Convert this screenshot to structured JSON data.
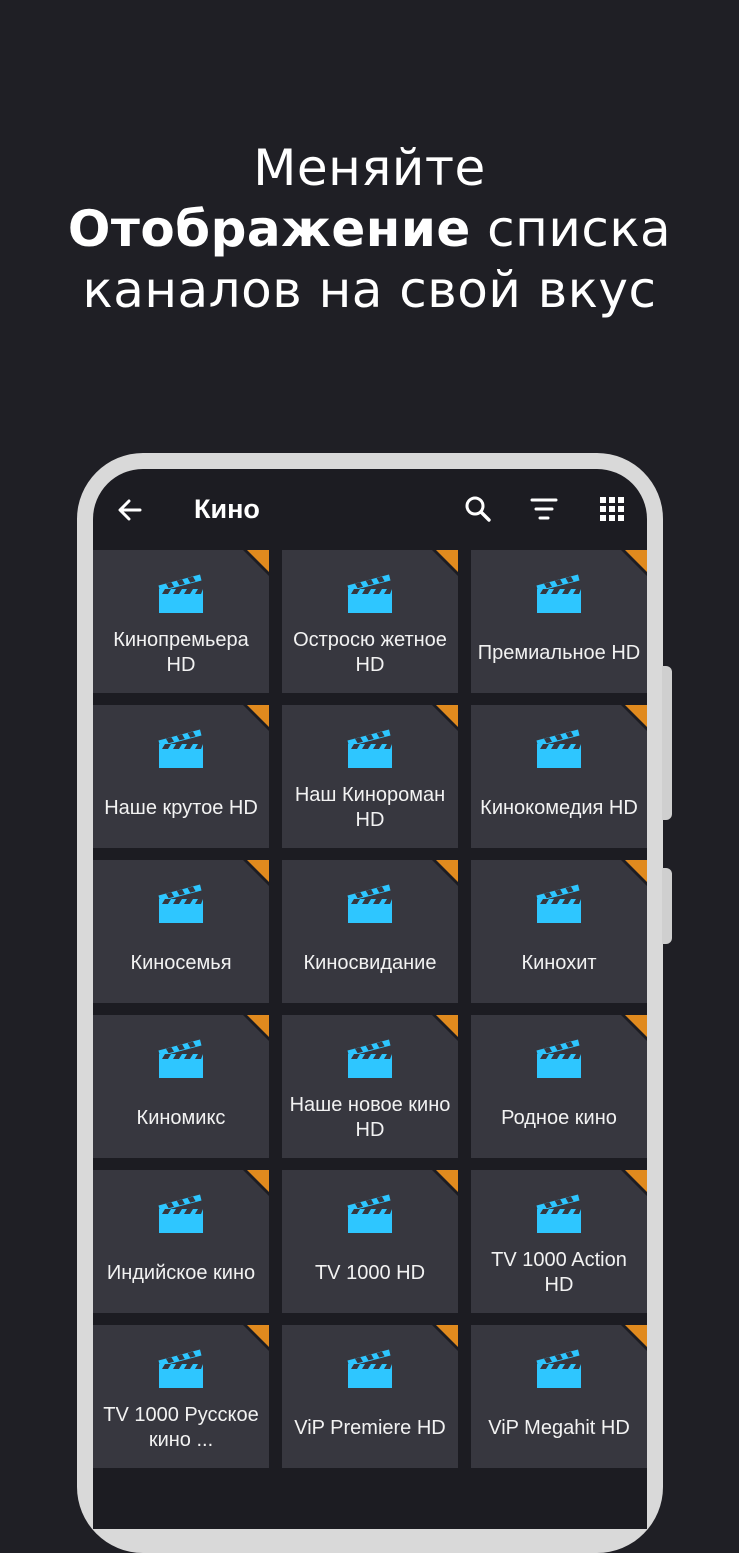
{
  "headline": {
    "line1": "Меняйте",
    "line2_bold": "Отображение",
    "line2_rest": " списка",
    "line3": "каналов на свой вкус"
  },
  "appbar": {
    "title": "Кино",
    "back_icon": "arrow-left-icon",
    "search_icon": "search-icon",
    "filter_icon": "filter-icon",
    "grid_icon": "grid-view-icon"
  },
  "colors": {
    "background": "#1f1f25",
    "screen": "#1c1c22",
    "tile": "#37373f",
    "accent_corner": "#e08a1e",
    "icon_blue": "#2ec6ff"
  },
  "channels": [
    {
      "name": "Кинопремьера HD"
    },
    {
      "name": "Остросю жетное HD"
    },
    {
      "name": "Премиальное HD"
    },
    {
      "name": "Наше крутое HD"
    },
    {
      "name": "Наш Кинороман HD"
    },
    {
      "name": "Кинокомедия HD"
    },
    {
      "name": "Киносемья"
    },
    {
      "name": "Киносвидание"
    },
    {
      "name": "Кинохит"
    },
    {
      "name": "Киномикс"
    },
    {
      "name": "Наше новое кино HD"
    },
    {
      "name": "Родное кино"
    },
    {
      "name": "Индийское кино"
    },
    {
      "name": "TV 1000 HD"
    },
    {
      "name": "TV 1000 Action HD"
    },
    {
      "name": "TV 1000 Русское кино ..."
    },
    {
      "name": "ViP Premiere HD"
    },
    {
      "name": "ViP Megahit HD"
    }
  ]
}
